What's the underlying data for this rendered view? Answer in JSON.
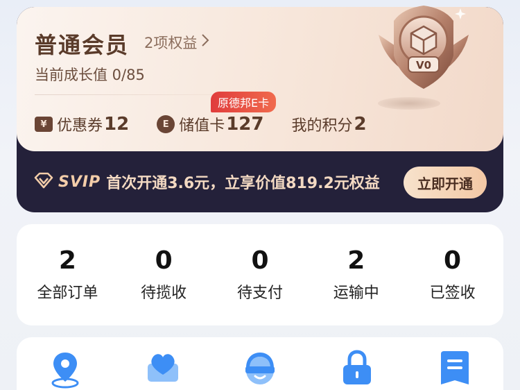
{
  "member": {
    "level_title": "普通会员",
    "benefits_label": "2项权益",
    "growth_label": "当前成长值 0/85",
    "badge_level": "V0",
    "promo_tag": "原德邦E卡",
    "stats": [
      {
        "icon": "coupon-icon",
        "icon_glyph": "¥",
        "label": "优惠券",
        "value": "12"
      },
      {
        "icon": "stored-value-card-icon",
        "icon_glyph": "E",
        "label": "储值卡",
        "value": "127"
      },
      {
        "icon": "",
        "icon_glyph": "",
        "label": "我的积分",
        "value": "2"
      }
    ]
  },
  "svip": {
    "logo": "SVIP",
    "text": "首次开通3.6元，立享价值819.2元权益",
    "button_label": "立即开通"
  },
  "orders": [
    {
      "count": "2",
      "label": "全部订单"
    },
    {
      "count": "0",
      "label": "待揽收"
    },
    {
      "count": "0",
      "label": "待支付"
    },
    {
      "count": "2",
      "label": "运输中"
    },
    {
      "count": "0",
      "label": "已签收"
    }
  ],
  "tools": [
    {
      "icon": "location-pin-icon"
    },
    {
      "icon": "heart-mail-icon"
    },
    {
      "icon": "customer-service-icon"
    },
    {
      "icon": "lock-icon"
    },
    {
      "icon": "receipt-icon"
    }
  ],
  "colors": {
    "brown": "#5a3b2a",
    "svip_bg": "#24213a",
    "gold": "#f3cda9",
    "blue": "#3d8ef5"
  }
}
